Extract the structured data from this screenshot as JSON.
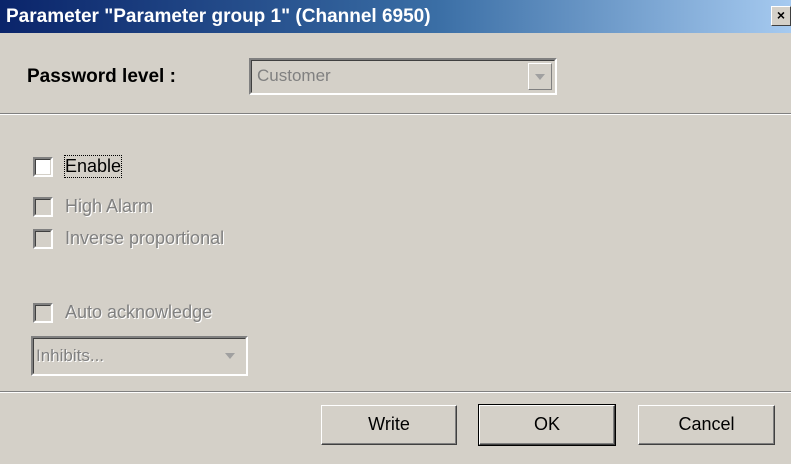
{
  "window": {
    "title": "Parameter \"Parameter group 1\" (Channel 6950)",
    "close_glyph": "×"
  },
  "password": {
    "label": "Password level :",
    "value": "Customer"
  },
  "checkboxes": {
    "enable": {
      "label": "Enable",
      "checked": false,
      "enabled": true
    },
    "high_alarm": {
      "label": "High Alarm",
      "checked": false,
      "enabled": false
    },
    "inverse_proportional": {
      "label": "Inverse proportional",
      "checked": false,
      "enabled": false
    },
    "auto_acknowledge": {
      "label": "Auto acknowledge",
      "checked": false,
      "enabled": false
    }
  },
  "inhibits": {
    "value": "Inhibits..."
  },
  "buttons": {
    "write": "Write",
    "ok": "OK",
    "cancel": "Cancel"
  },
  "icons": {
    "close": "close-icon",
    "dropdown": "chevron-down-icon"
  }
}
